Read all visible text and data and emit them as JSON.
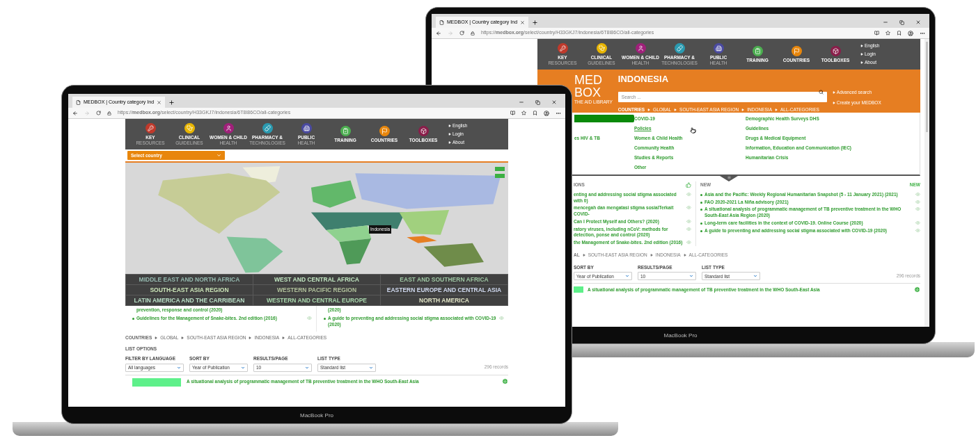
{
  "back_laptop": {
    "label": "MacBook Pro",
    "browser": {
      "tab_title": "MEDBOX | Country category Ind",
      "url": "https://**medbox.org**/select/country/H33GKJ7/indonesia/6T8I86CO/all-categories"
    },
    "header": {
      "nav": [
        {
          "label": "KEY",
          "sublabel": "RESOURCES",
          "color": "#c0392b"
        },
        {
          "label": "CLINICAL",
          "sublabel": "GUIDELINES",
          "color": "#e8b500"
        },
        {
          "label": "WOMEN & CHILD",
          "sublabel": "HEALTH",
          "color": "#a0207a"
        },
        {
          "label": "PHARMACY &",
          "sublabel": "TECHNOLOGIES",
          "color": "#2a9ab0"
        },
        {
          "label": "PUBLIC",
          "sublabel": "HEALTH",
          "color": "#4a4aa0"
        },
        {
          "label": "TRAINING",
          "color": "#4caf50"
        },
        {
          "label": "COUNTRIES",
          "color": "#e8860c"
        },
        {
          "label": "TOOLBOXES",
          "color": "#8a1e4a"
        }
      ],
      "links": [
        "English",
        "Login",
        "About"
      ]
    },
    "logo": {
      "line_1": "MED",
      "line_2": "BOX",
      "tagline": "THE AID LIBRARY"
    },
    "page_title": "INDONESIA",
    "search": {
      "placeholder": "Search ..."
    },
    "side_links": [
      "Advanced search",
      "Create your MEDBOX"
    ],
    "breadcrumb": [
      "COUNTRIES",
      "GLOBAL",
      "SOUTH-EAST ASIA REGION",
      "INDONESIA",
      "ALL-CATEGORIES"
    ],
    "menu": {
      "left": [
        {
          "selected": true
        },
        {
          "label": "es HIV & TB",
          "selected": false
        }
      ],
      "middle": [
        {
          "label": "COVID-19",
          "hovered": false
        },
        {
          "label": "Policies",
          "hovered": true
        },
        {
          "label": "Women & Child Health",
          "hovered": false
        },
        {
          "label": "Community Health",
          "hovered": false
        },
        {
          "label": "Studies & Reports",
          "hovered": false
        },
        {
          "label": "Other",
          "hovered": false
        }
      ],
      "right": [
        {
          "label": "Demographic Health Surveys DHS",
          "hovered": false
        },
        {
          "label": "Guidelines",
          "hovered": false
        },
        {
          "label": "Drugs & Medical Equipment",
          "hovered": false
        },
        {
          "label": "Information, Education and Communication (IEC)",
          "hovered": false
        },
        {
          "label": "Humanitarian Crisis",
          "hovered": false
        }
      ]
    },
    "recommended": {
      "title": "IONS",
      "items": [
        "enting and addressing social stigma associated with 0)",
        "mencegah dan mengatasi stigma sosialTerkait COVID-",
        "Can I Protect Myself and Others? (2020)",
        "ratory viruses, including nCoV: methods for detection, ponse and control (2020)",
        "the Management of Snake-bites. 2nd edition (2016)"
      ]
    },
    "new": {
      "title": "NEW",
      "badge": "NEW",
      "items": [
        "Asia and the Pacific: Weekly Regional Humanitarian Snapshot (5 - 11 January 2021) (2021)",
        "FAO 2020-2021 La Niña advisory (2021)",
        "A situational analysis of programmatic management of TB preventive treatment in the WHO South-East Asia Region (2020)",
        "Long-term care facilities in the context of COVID-19. Online Course (2020)",
        "A guide to preventing and addressing social stigma associated with COVID-19 (2020)"
      ]
    },
    "bottom_breadcrumb": [
      "AL",
      "SOUTH-EAST ASIA REGION",
      "INDONESIA",
      "ALL-CATEGORIES"
    ],
    "filters": [
      {
        "label": "SORT BY",
        "value": "Year of Publication"
      },
      {
        "label": "RESULTS/PAGE",
        "value": "10"
      },
      {
        "label": "LIST TYPE",
        "value": "Standard list"
      }
    ],
    "records": "296 records",
    "record_title": "A situational analysis of programmatic management of TB preventive treatment in the WHO South-East Asia"
  },
  "front_laptop": {
    "label": "MacBook Pro",
    "browser": {
      "tab_title": "MEDBOX | Country category Ind",
      "url": "https://**medbox.org**/select/country/H33GKJ7/indonesia/6T8I86CO/all-categories"
    },
    "header": {
      "nav": [
        {
          "label": "KEY",
          "sublabel": "RESOURCES",
          "color": "#c0392b"
        },
        {
          "label": "CLINICAL",
          "sublabel": "GUIDELINES",
          "color": "#e8b500"
        },
        {
          "label": "WOMEN & CHILD",
          "sublabel": "HEALTH",
          "color": "#a0207a"
        },
        {
          "label": "PHARMACY &",
          "sublabel": "TECHNOLOGIES",
          "color": "#2a9ab0"
        },
        {
          "label": "PUBLIC",
          "sublabel": "HEALTH",
          "color": "#4a4aa0"
        },
        {
          "label": "TRAINING",
          "color": "#4caf50"
        },
        {
          "label": "COUNTRIES",
          "color": "#e8860c"
        },
        {
          "label": "TOOLBOXES",
          "color": "#8a1e4a"
        }
      ],
      "links": [
        "English",
        "Login",
        "About"
      ]
    },
    "country_select": "Select country",
    "map_tooltip": "Indonesia",
    "regions": [
      {
        "label": "MIDDLE EAST AND NORTH AFRICA",
        "color": "#3f7f6e"
      },
      {
        "label": "WEST AND CENTRAL AFRICA",
        "color": "#8fd18f"
      },
      {
        "label": "EAST AND SOUTHERN AFRICA",
        "color": "#4f9a58"
      },
      {
        "label": "SOUTH-EAST ASIA REGION",
        "color": "#a1d07e"
      },
      {
        "label": "WESTERN PACIFIC REGION",
        "color": "#6f8c4a"
      },
      {
        "label": "EASTERN EUROPE AND CENTRAL ASIA",
        "color": "#a9b9e2"
      },
      {
        "label": "LATIN AMERICA AND THE CARRIBEAN",
        "color": "#7fc49a"
      },
      {
        "label": "WESTERN AND CENTRAL EUROPE",
        "color": "#62b86a"
      },
      {
        "label": "NORTH AMERICA",
        "color": "#c6cc96"
      }
    ],
    "left_list": [
      {
        "text": "prevention, response and control (2020)",
        "partial": true
      },
      {
        "text": "Guidelines for the Management of Snake-bites. 2nd edition (2016)",
        "partial": false
      }
    ],
    "right_list": [
      {
        "text": "(2020)",
        "partial": true
      },
      {
        "text": "A guide to preventing and addressing social stigma associated with COVID-19 (2020)",
        "partial": false
      }
    ],
    "breadcrumb": [
      "COUNTRIES",
      "GLOBAL",
      "SOUTH-EAST ASIA REGION",
      "INDONESIA",
      "ALL-CATEGORIES"
    ],
    "list_options": "LIST OPTIONS",
    "filters": [
      {
        "label": "FILTER BY LANGUAGE",
        "value": "All languages"
      },
      {
        "label": "SORT BY",
        "value": "Year of Publication"
      },
      {
        "label": "RESULTS/PAGE",
        "value": "10"
      },
      {
        "label": "LIST TYPE",
        "value": "Standard list"
      }
    ],
    "records": "296 records",
    "record_title": "A situational analysis of programmatic management of TB preventive treatment in the WHO South-East Asia"
  }
}
